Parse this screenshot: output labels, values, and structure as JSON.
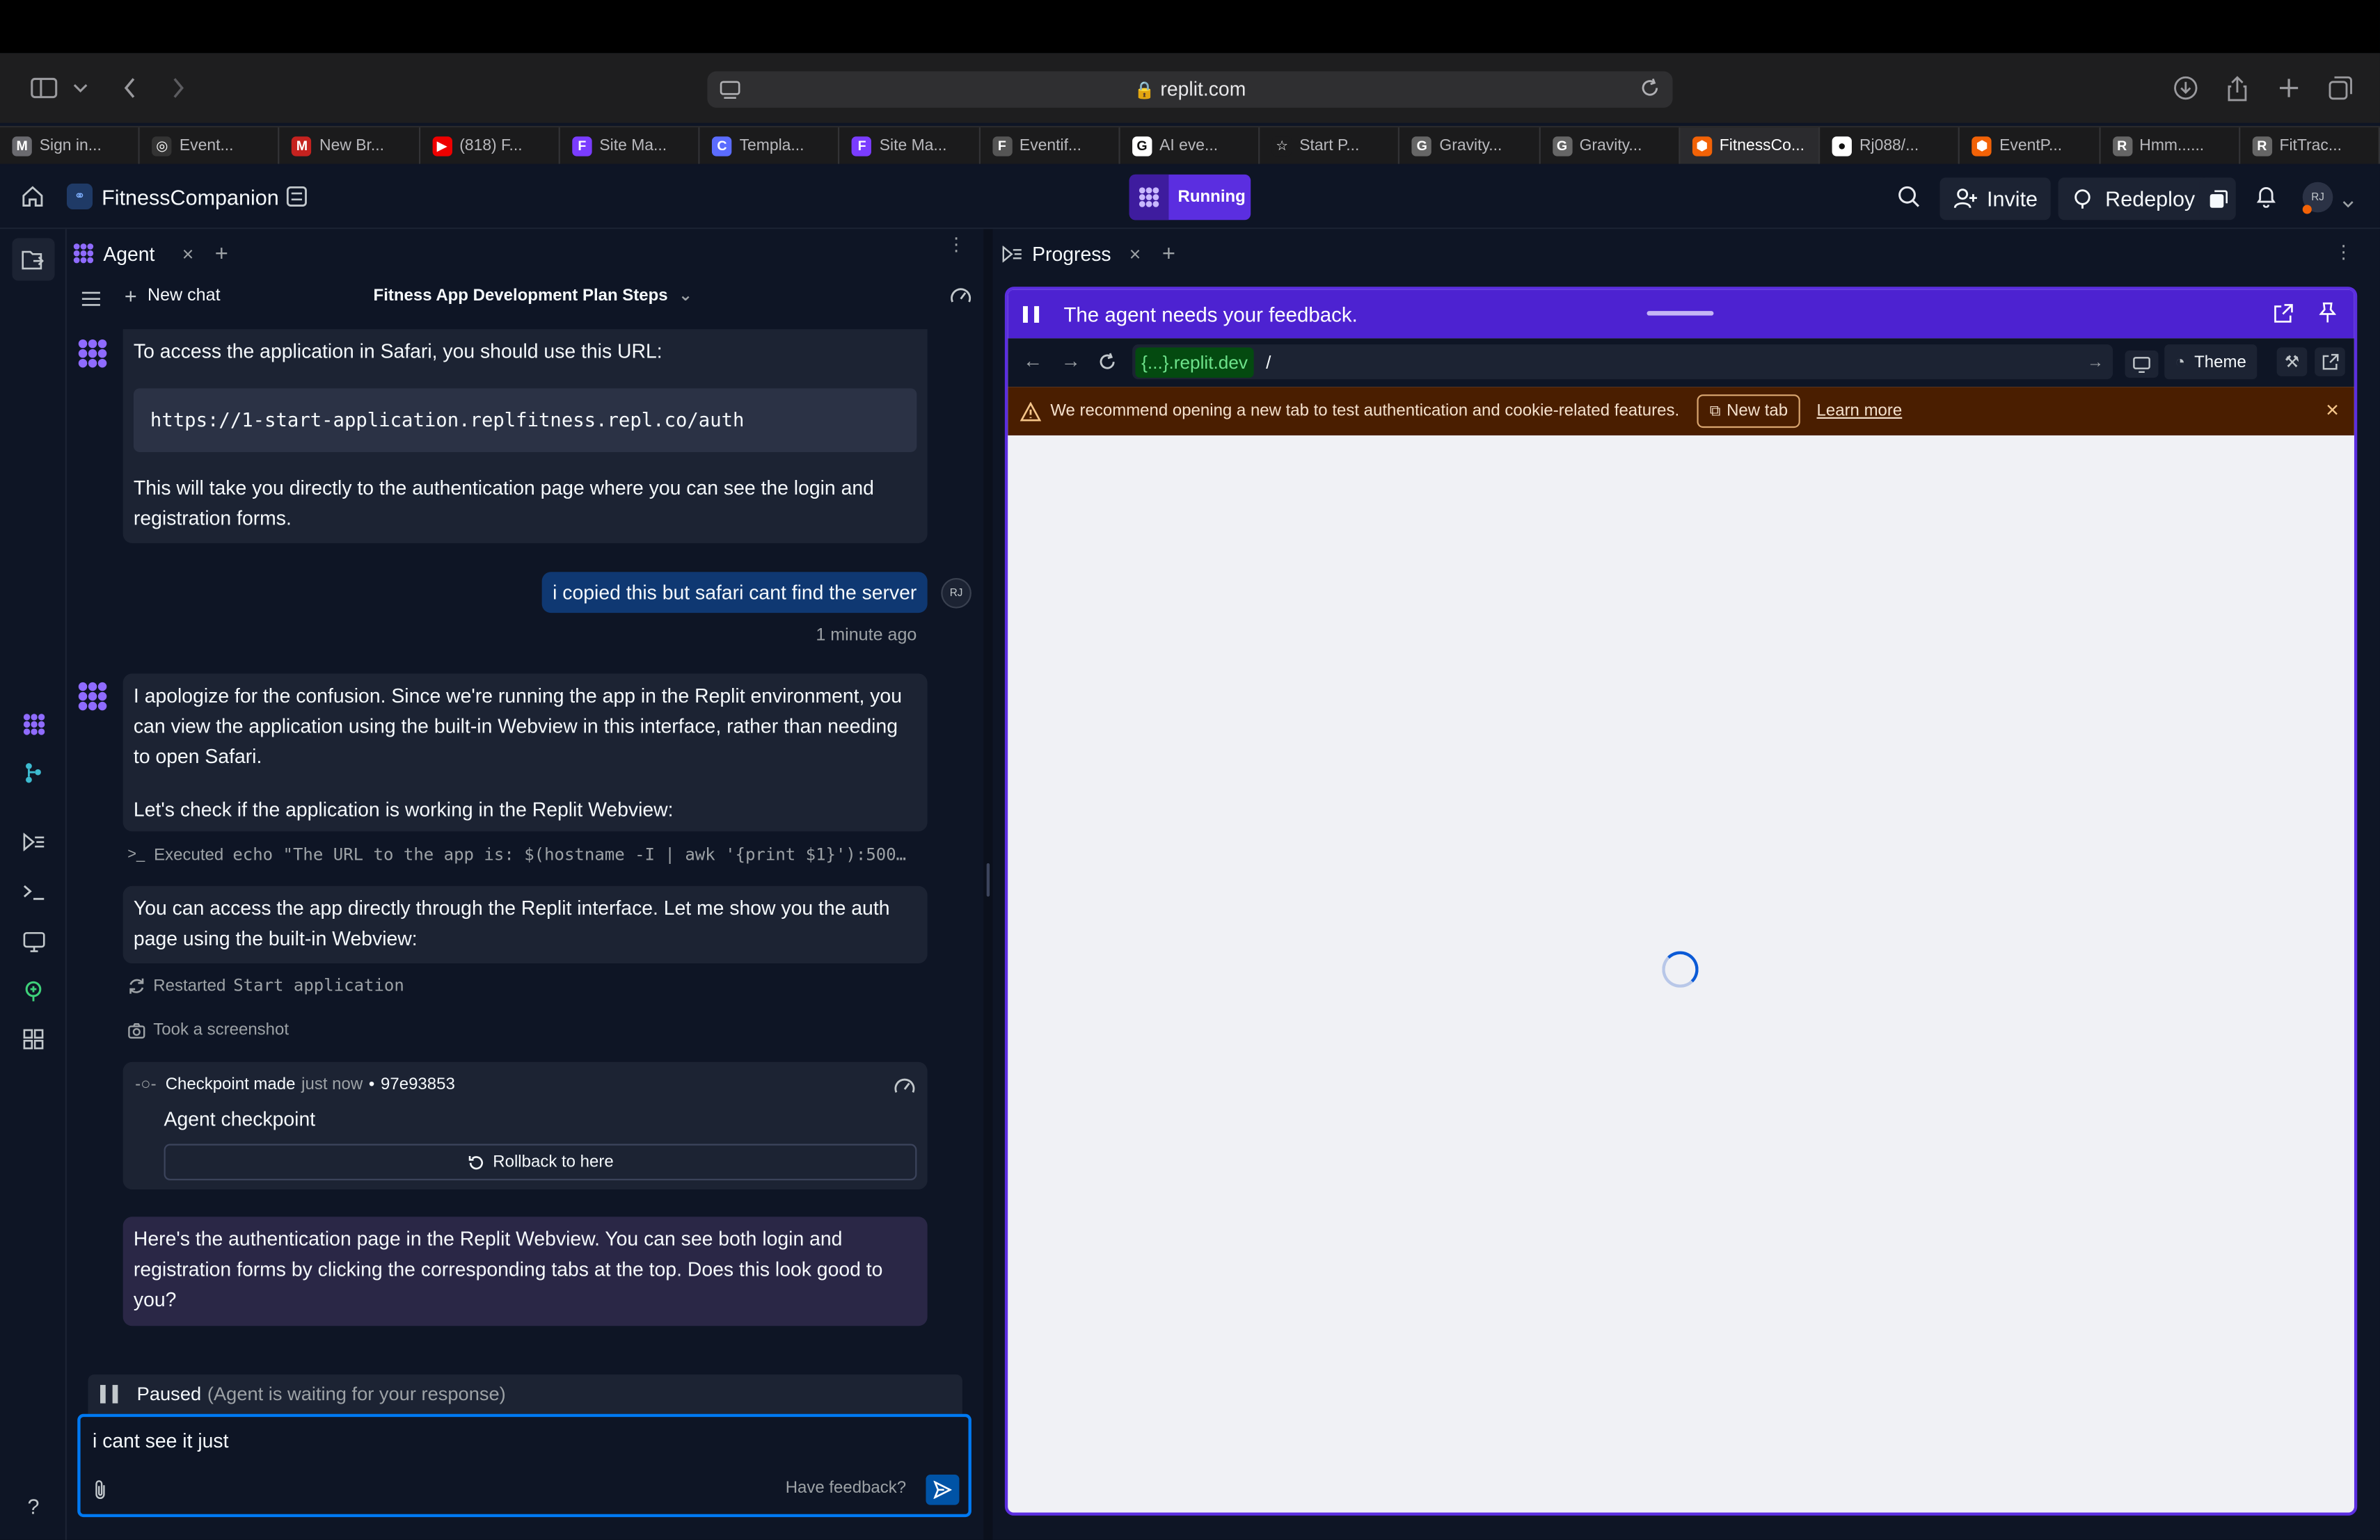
{
  "browser": {
    "url": "replit.com",
    "tabs": [
      {
        "label": "Sign in...",
        "fav": "M",
        "color": "#6a6a6f"
      },
      {
        "label": "Event...",
        "fav": "◎",
        "color": "#333"
      },
      {
        "label": "New Br...",
        "fav": "M",
        "color": "#c5221f"
      },
      {
        "label": "(818) F...",
        "fav": "▶",
        "color": "#e00"
      },
      {
        "label": "Site Ma...",
        "fav": "F",
        "color": "#7a3cff"
      },
      {
        "label": "Templa...",
        "fav": "C",
        "color": "#5b6cff"
      },
      {
        "label": "Site Ma...",
        "fav": "F",
        "color": "#7a3cff"
      },
      {
        "label": "Eventif...",
        "fav": "F",
        "color": "#555"
      },
      {
        "label": "AI  eve...",
        "fav": "G",
        "color": "#fff"
      },
      {
        "label": "Start P...",
        "fav": "☆",
        "color": "#1b1b1c"
      },
      {
        "label": "Gravity...",
        "fav": "G",
        "color": "#666"
      },
      {
        "label": "Gravity...",
        "fav": "G",
        "color": "#666"
      },
      {
        "label": "FitnessCo...",
        "fav": "⬢",
        "color": "#f26207",
        "active": true
      },
      {
        "label": "Rj088/...",
        "fav": "●",
        "color": "#fff"
      },
      {
        "label": "EventP...",
        "fav": "⬢",
        "color": "#f26207"
      },
      {
        "label": "Hmm......",
        "fav": "R",
        "color": "#666"
      },
      {
        "label": "FitTrac...",
        "fav": "R",
        "color": "#666"
      }
    ]
  },
  "header": {
    "project_name": "FitnessCompanion",
    "status": "Running",
    "invite": "Invite",
    "redeploy": "Redeploy",
    "avatar": "RJ"
  },
  "agent": {
    "tab_label": "Agent",
    "new_chat": "New chat",
    "chat_title": "Fitness App Development Plan Steps",
    "msg1_intro": "To access the application in Safari, you should use this URL:",
    "msg1_code": "https://1-start-application.replfitness.repl.co/auth",
    "msg1_outro": "This will take you directly to the authentication page where you can see the login and registration forms.",
    "user_msg": "i copied this but safari cant find the server",
    "user_time": "1 minute ago",
    "user_avatar": "RJ",
    "msg2_p1": "I apologize for the confusion. Since we're running the app in the Replit environment, you can view the application using the built-in Webview in this interface, rather than needing to open Safari.",
    "msg2_p2": "Let's check if the application is working in the Replit Webview:",
    "executed_label": "Executed",
    "executed_cmd": "echo \"The URL to the app is: $(hostname -I | awk '{print $1}'):500…",
    "msg3": "You can access the app directly through the Replit interface. Let me show you the auth page using the built-in Webview:",
    "restarted_label": "Restarted",
    "restarted_target": "Start application",
    "screenshot_label": "Took a screenshot",
    "checkpoint_label": "Checkpoint made",
    "checkpoint_time": "just now",
    "checkpoint_hash": "97e93853",
    "checkpoint_title": "Agent checkpoint",
    "rollback": "Rollback to here",
    "msg4": "Here's the authentication page in the Replit Webview. You can see both login and registration forms by clicking the corresponding tabs at the top. Does this look good to you?",
    "paused": "Paused",
    "paused_note": "(Agent is waiting for your response)",
    "input_value": "i cant see it just",
    "feedback_link": "Have feedback?"
  },
  "progress": {
    "tab_label": "Progress",
    "feedback_banner": "The agent needs your feedback.",
    "webview_domain": "{...}.replit.dev",
    "webview_path": "/",
    "theme": "Theme",
    "warning": "We recommend opening a new tab to test authentication and cookie-related features.",
    "new_tab": "New tab",
    "learn_more": "Learn more"
  },
  "colors": {
    "bg": "#0e1525",
    "surface": "#1c2333",
    "accent": "#5b2ee0",
    "user_bubble": "#0f3872",
    "warning_bg": "#4a1e00",
    "link_blue": "#0079f2"
  }
}
